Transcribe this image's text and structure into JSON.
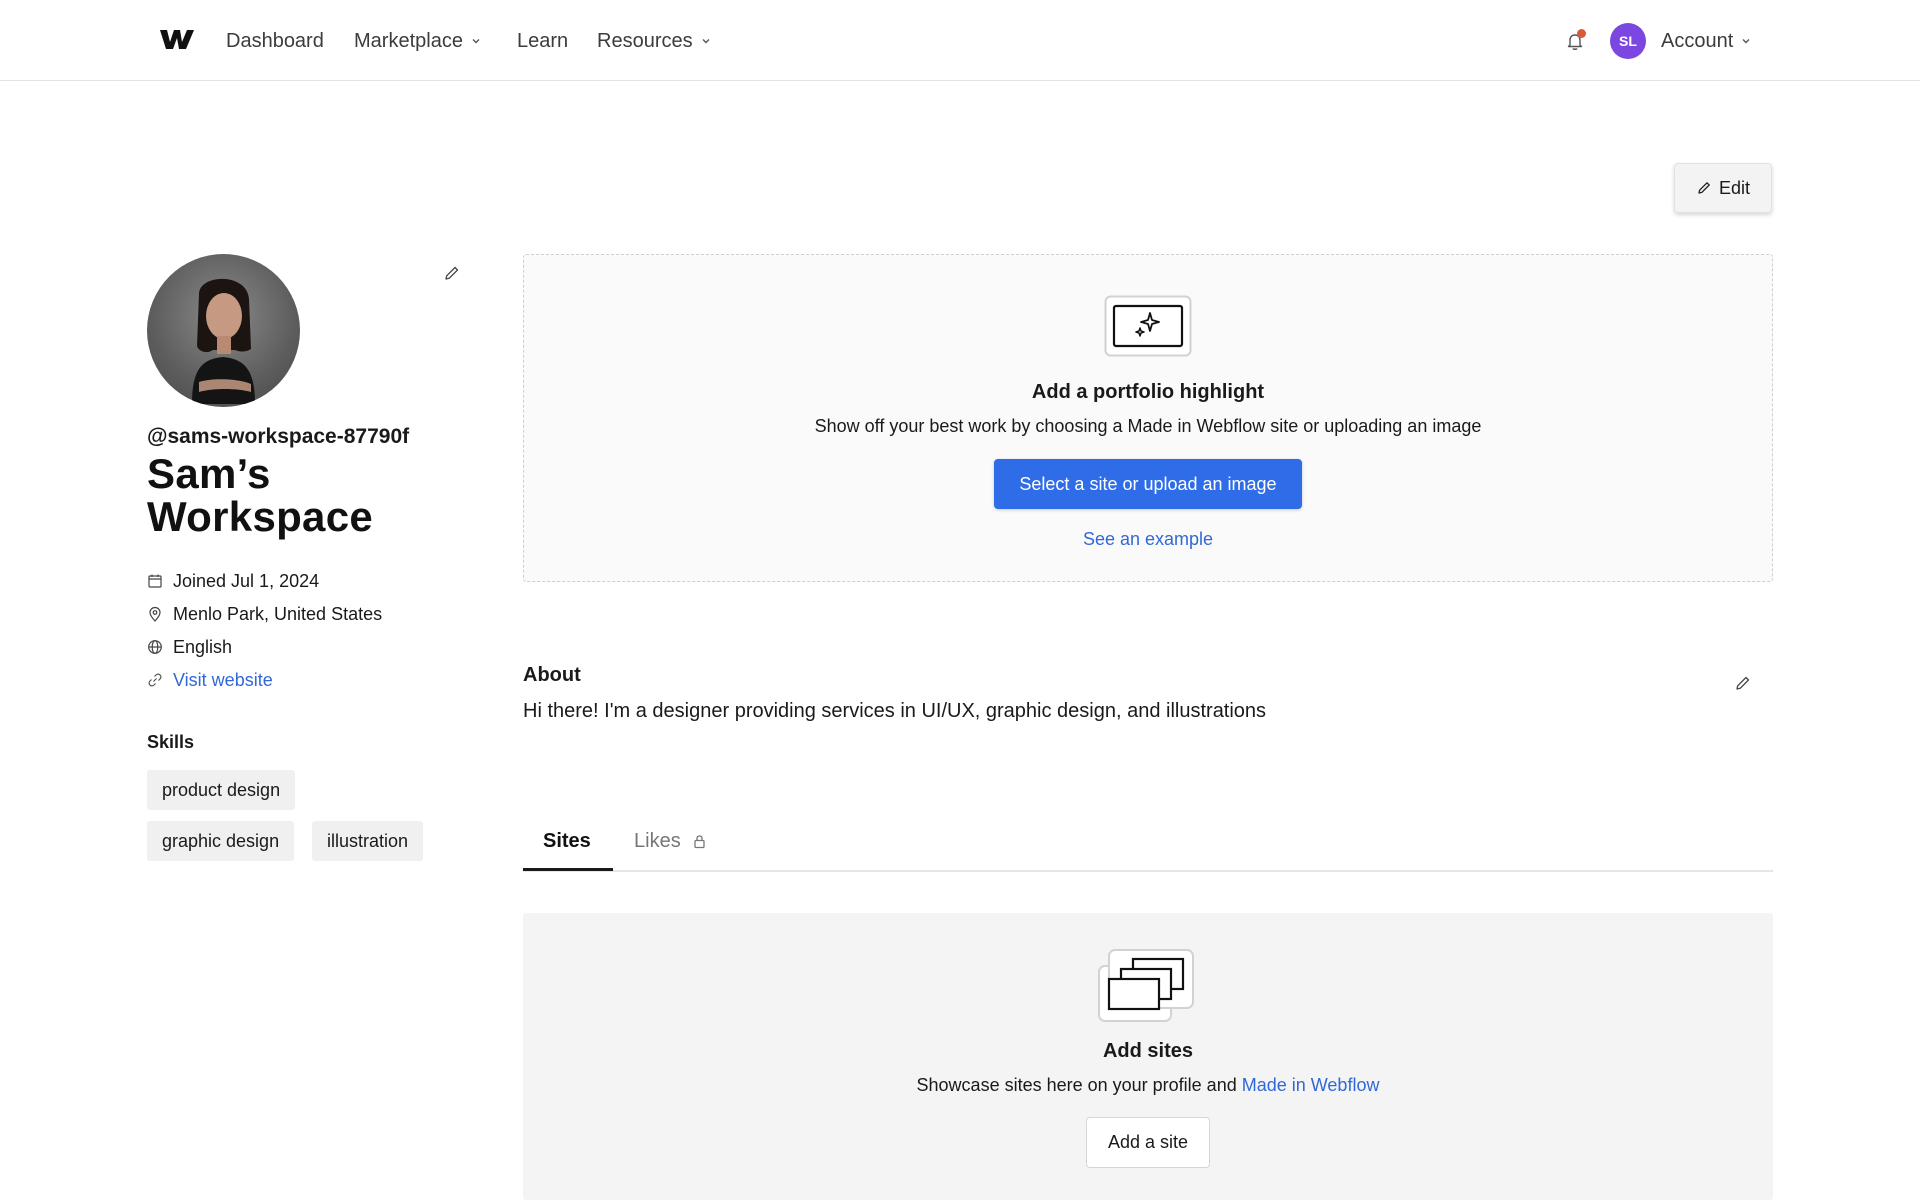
{
  "nav": {
    "items": [
      {
        "label": "Dashboard"
      },
      {
        "label": "Marketplace"
      },
      {
        "label": "Learn"
      },
      {
        "label": "Resources"
      }
    ],
    "account_initials": "SL",
    "account_label": "Account",
    "accent": "#7b47e0"
  },
  "header": {
    "edit_label": "Edit"
  },
  "profile": {
    "handle": "@sams-workspace-87790f",
    "display_name": "Sam’s Workspace",
    "joined": "Joined Jul 1, 2024",
    "location": "Menlo Park, United States",
    "language": "English",
    "website_label": "Visit website",
    "skills_title": "Skills",
    "skills": [
      "product design",
      "graphic design",
      "illustration"
    ]
  },
  "highlight": {
    "title": "Add a portfolio highlight",
    "description": "Show off your best work by choosing a Made in Webflow site or uploading an image",
    "button_label": "Select a site or upload an image",
    "link_label": "See an example",
    "button_color": "#2f6ce8"
  },
  "about": {
    "title": "About",
    "text": "Hi there! I'm a designer providing services in UI/UX, graphic design, and illustrations"
  },
  "tabs": [
    {
      "label": "Sites",
      "active": true
    },
    {
      "label": "Likes",
      "active": false,
      "icon": "lock-icon"
    }
  ],
  "sites": {
    "title": "Add sites",
    "description_prefix": "Showcase sites here on your profile and ",
    "description_link": "Made in Webflow",
    "button_label": "Add a site"
  }
}
